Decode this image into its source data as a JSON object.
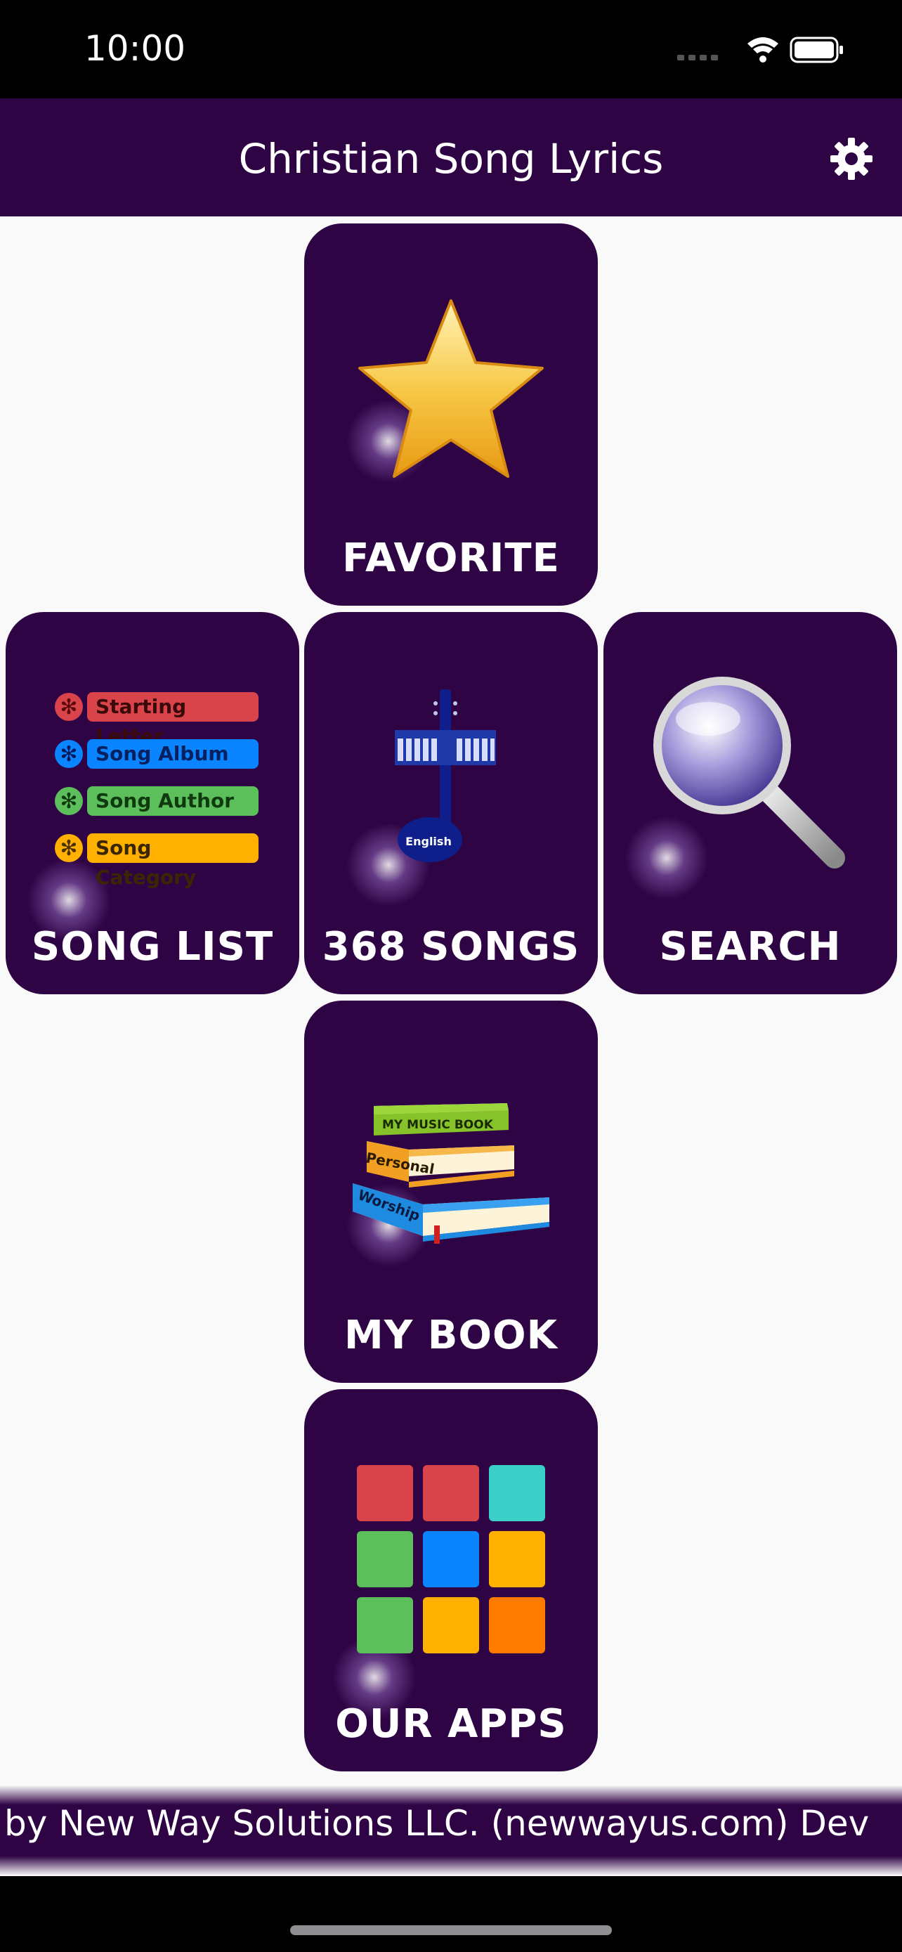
{
  "status_bar": {
    "time": "10:00"
  },
  "header": {
    "title": "Christian Song Lyrics"
  },
  "cards": {
    "favorite": {
      "label": "FAVORITE"
    },
    "song_list": {
      "label": "SONG LIST",
      "items": [
        {
          "text": "Starting Letter",
          "color": "#d9444a"
        },
        {
          "text": "Song Album",
          "color": "#0a84ff"
        },
        {
          "text": "Song Author",
          "color": "#5cbf5c"
        },
        {
          "text": "Song Category",
          "color": "#ffb000"
        }
      ]
    },
    "songs": {
      "label": "368 SONGS",
      "icon_caption": "English"
    },
    "search": {
      "label": "SEARCH"
    },
    "my_book": {
      "label": "MY BOOK",
      "books": [
        "MY MUSIC BOOK",
        "Personal",
        "Worship"
      ]
    },
    "our_apps": {
      "label": "OUR APPS",
      "tile_colors": [
        "#d9434a",
        "#d9434a",
        "#3ad0c8",
        "#5cbf5c",
        "#0a84ff",
        "#ffb000",
        "#5cbf5c",
        "#ffb000",
        "#ff7a00"
      ]
    }
  },
  "footer": {
    "marquee": "by New Way Solutions LLC. (newwayus.com)    Dev"
  },
  "colors": {
    "brand": "#2f0445"
  }
}
